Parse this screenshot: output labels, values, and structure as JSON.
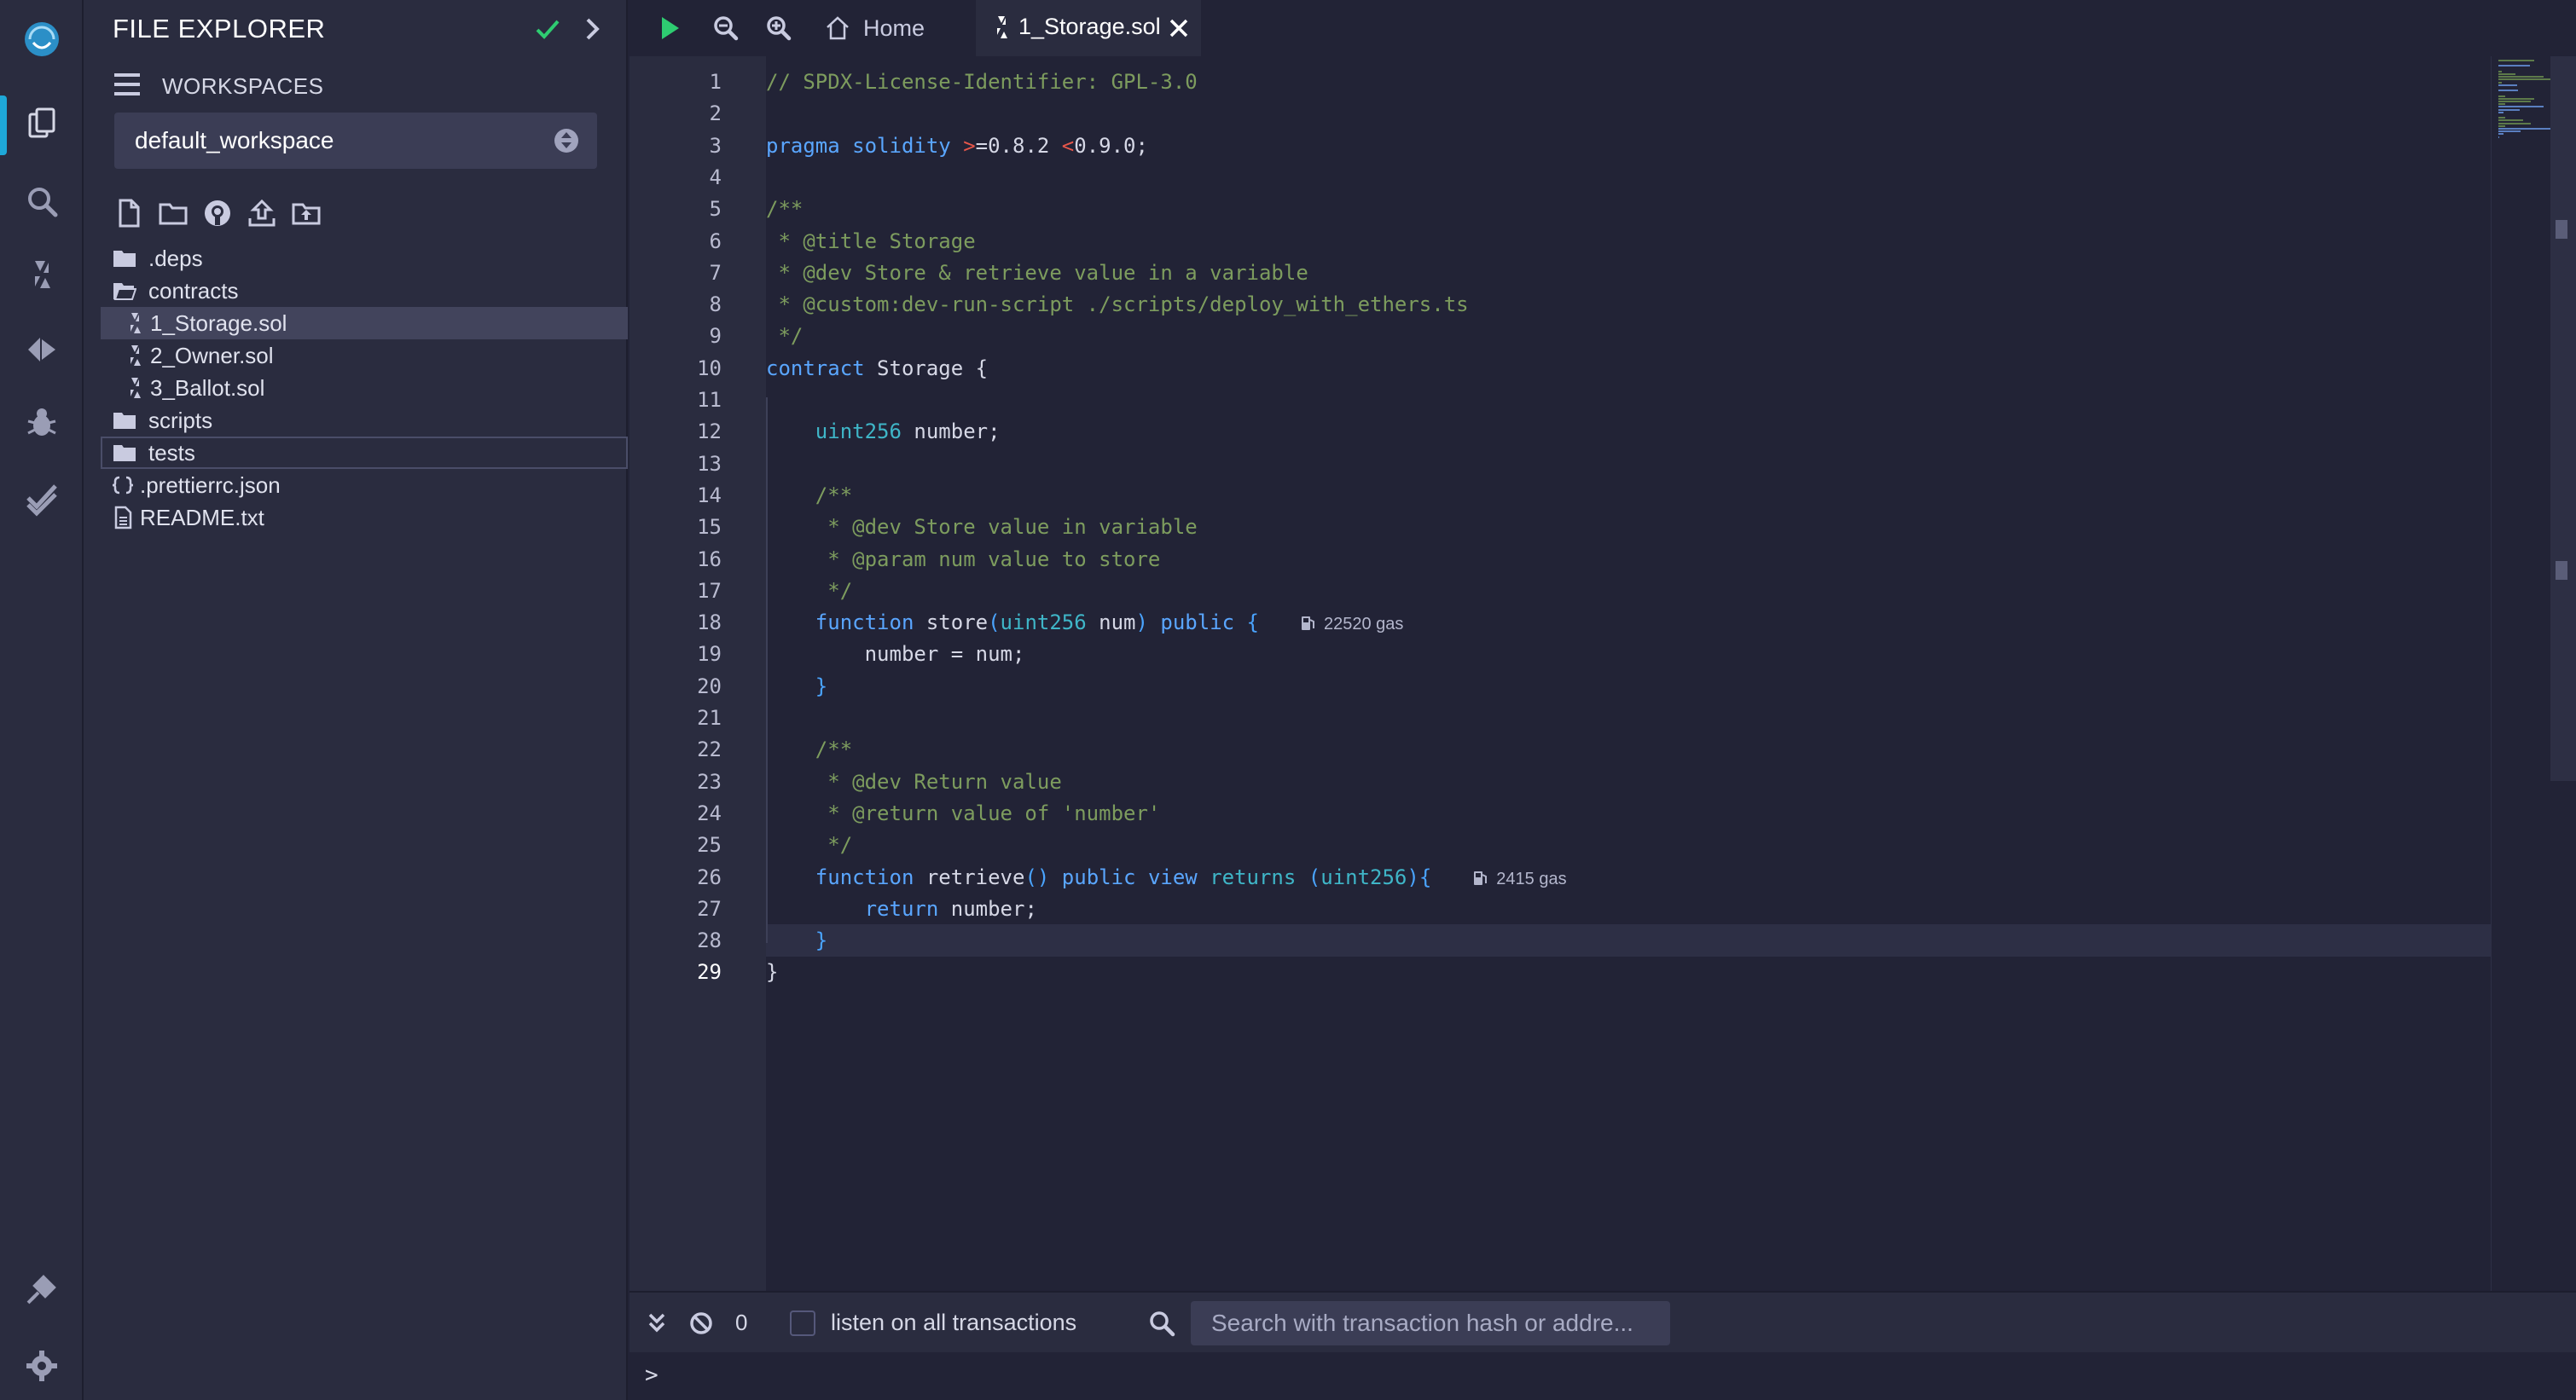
{
  "side_panel": {
    "title": "FILE EXPLORER",
    "workspaces_label": "WORKSPACES",
    "selected_workspace": "default_workspace"
  },
  "file_tree": [
    {
      "name": ".deps",
      "kind": "folder"
    },
    {
      "name": "contracts",
      "kind": "folder-open"
    },
    {
      "name": "1_Storage.sol",
      "kind": "sol",
      "selected": true
    },
    {
      "name": "2_Owner.sol",
      "kind": "sol"
    },
    {
      "name": "3_Ballot.sol",
      "kind": "sol"
    },
    {
      "name": "scripts",
      "kind": "folder"
    },
    {
      "name": "tests",
      "kind": "folder",
      "focused": true
    },
    {
      "name": ".prettierrc.json",
      "kind": "json"
    },
    {
      "name": "README.txt",
      "kind": "file"
    }
  ],
  "tabs": {
    "home": "Home",
    "active": "1_Storage.sol"
  },
  "editor": {
    "current_line": 29,
    "line_count": 29,
    "gas_store": "22520 gas",
    "gas_retrieve": "2415 gas"
  },
  "terminal": {
    "pending_count": "0",
    "listen_label": "listen on all transactions",
    "search_placeholder": "Search with transaction hash or addre...",
    "prompt": ">"
  },
  "colors": {
    "accent": "#1ea8d8",
    "run_green": "#2ecc71",
    "check_green": "#2ecc71"
  }
}
